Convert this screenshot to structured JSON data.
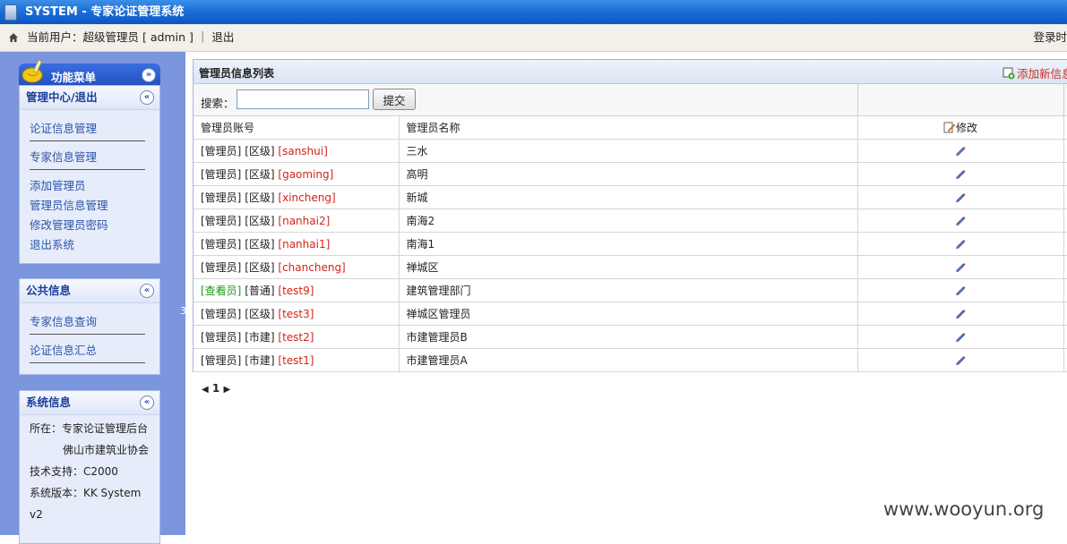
{
  "window": {
    "title": "SYSTEM - 专家论证管理系统"
  },
  "userbar": {
    "current_user_text": "当前用户：超级管理员 [ admin ] ｜",
    "logout_label": "退出",
    "right_text": "登录时"
  },
  "sidebar": {
    "menu_title": "功能菜单",
    "panels": [
      {
        "title": "管理中心/退出",
        "items": [
          "论证信息管理",
          "专家信息管理",
          "添加管理员",
          "管理员信息管理",
          "修改管理员密码",
          "退出系统"
        ]
      },
      {
        "title": "公共信息",
        "items": [
          "专家信息查询",
          "论证信息汇总"
        ]
      },
      {
        "title": "系统信息",
        "lines": [
          "所在：专家论证管理后台",
          "佛山市建筑业协会",
          "技术支持：C2000",
          "系统版本：KK System",
          "v2"
        ]
      }
    ],
    "side_tab": "3"
  },
  "main": {
    "list_title": "管理员信息列表",
    "add_label": "添加新信息",
    "search_label": "搜索：",
    "search_value": "",
    "submit_label": "提交",
    "columns": [
      "管理员账号",
      "管理员名称",
      "修改"
    ],
    "rows": [
      {
        "role": "[管理员]",
        "role_type": "admin",
        "level": "[区级]",
        "account": "[sanshui]",
        "name": "三水"
      },
      {
        "role": "[管理员]",
        "role_type": "admin",
        "level": "[区级]",
        "account": "[gaoming]",
        "name": "高明"
      },
      {
        "role": "[管理员]",
        "role_type": "admin",
        "level": "[区级]",
        "account": "[xincheng]",
        "name": "新城"
      },
      {
        "role": "[管理员]",
        "role_type": "admin",
        "level": "[区级]",
        "account": "[nanhai2]",
        "name": "南海2"
      },
      {
        "role": "[管理员]",
        "role_type": "admin",
        "level": "[区级]",
        "account": "[nanhai1]",
        "name": "南海1"
      },
      {
        "role": "[管理员]",
        "role_type": "admin",
        "level": "[区级]",
        "account": "[chancheng]",
        "name": "禅城区"
      },
      {
        "role": "[查看员]",
        "role_type": "viewer",
        "level": "[普通]",
        "account": "[test9]",
        "name": "建筑管理部门"
      },
      {
        "role": "[管理员]",
        "role_type": "admin",
        "level": "[区级]",
        "account": "[test3]",
        "name": "禅城区管理员"
      },
      {
        "role": "[管理员]",
        "role_type": "admin",
        "level": "[市建]",
        "account": "[test2]",
        "name": "市建管理员B"
      },
      {
        "role": "[管理员]",
        "role_type": "admin",
        "level": "[市建]",
        "account": "[test1]",
        "name": "市建管理员A"
      }
    ],
    "pager": {
      "prev": "◀",
      "current": "1",
      "next": "▶"
    }
  },
  "watermark": "www.wooyun.org",
  "colors": {
    "title_bar": "#1d6fd8",
    "sidebar_bg": "#7b96dd",
    "account_red": "#d3231a",
    "viewer_green": "#1a9a1a"
  }
}
